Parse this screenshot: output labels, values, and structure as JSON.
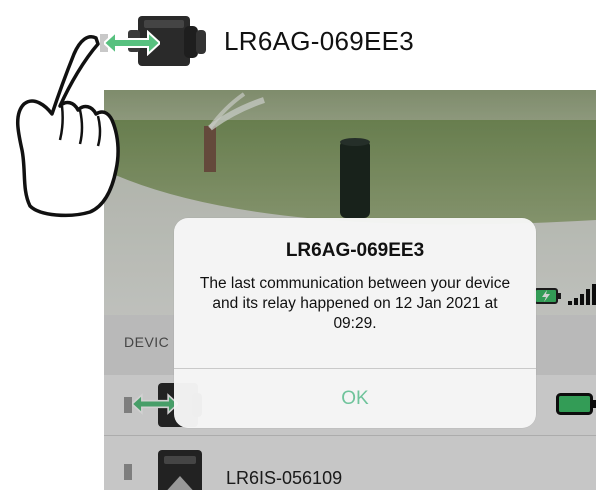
{
  "top_device": {
    "name": "LR6AG-069EE3",
    "icon": "device-with-relay-arrows-icon"
  },
  "device_list": {
    "section_label": "DEVIC",
    "rows": [
      {
        "icon": "device-with-relay-arrows-icon",
        "name": ""
      },
      {
        "icon": "device-icon",
        "name": "LR6IS-056109"
      }
    ]
  },
  "alert": {
    "title": "LR6AG-069EE3",
    "message": "The last communication between your device and its relay happened on 12 Jan 2021 at 09:29.",
    "button_label": "OK"
  },
  "colors": {
    "accent_green": "#6fc39b",
    "battery_green": "#3fbf6a",
    "arrow_green": "#57c17f"
  },
  "gesture": {
    "icon": "tap-hand-icon"
  }
}
